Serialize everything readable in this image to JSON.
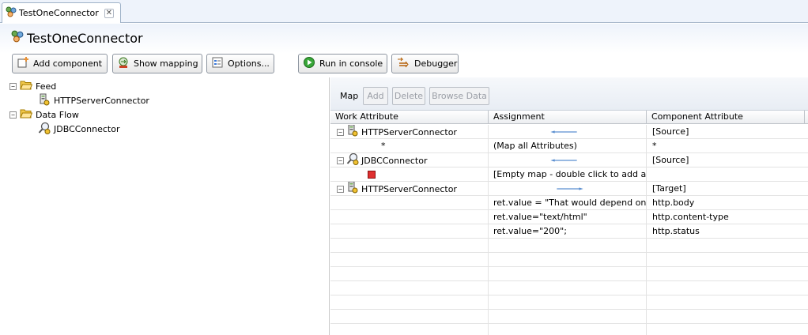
{
  "tab": {
    "label": "TestOneConnector",
    "close_glyph": "✕"
  },
  "header": {
    "title": "TestOneConnector"
  },
  "toolbar": {
    "add_component": "Add component",
    "show_mapping": "Show mapping",
    "options": "Options...",
    "run_in_console": "Run in console",
    "debugger": "Debugger"
  },
  "tree": {
    "feed": {
      "label": "Feed",
      "expanded": true
    },
    "feed_child": {
      "label": "HTTPServerConnector"
    },
    "dataflow": {
      "label": "Data Flow",
      "expanded": true
    },
    "dataflow_child": {
      "label": "JDBCConnector"
    }
  },
  "mapping": {
    "label": "Map",
    "buttons": {
      "add": "Add",
      "delete": "Delete",
      "browse": "Browse Data"
    },
    "columns": [
      "Work Attribute",
      "Assignment",
      "Component Attribute"
    ],
    "rows": [
      {
        "work": "HTTPServerConnector",
        "assignment": "",
        "component": "[Source]",
        "kind": "header",
        "arrow": "left"
      },
      {
        "work": "*",
        "assignment": "(Map all Attributes)",
        "component": "*",
        "kind": "detail"
      },
      {
        "work": "JDBCConnector",
        "assignment": "",
        "component": "[Source]",
        "kind": "header",
        "arrow": "left"
      },
      {
        "work": "",
        "assignment": "[Empty map - double click to add att",
        "component": "",
        "kind": "empty"
      },
      {
        "work": "HTTPServerConnector",
        "assignment": "",
        "component": "[Target]",
        "kind": "header",
        "arrow": "right"
      },
      {
        "work": "",
        "assignment": "ret.value = \"That would depend on y",
        "component": "http.body",
        "kind": "detail"
      },
      {
        "work": "",
        "assignment": "ret.value=\"text/html\"",
        "component": "http.content-type",
        "kind": "detail"
      },
      {
        "work": "",
        "assignment": "ret.value=\"200\";",
        "component": "http.status",
        "kind": "detail"
      }
    ]
  },
  "colors": {
    "accent": "#5b8fd0",
    "error_marker": "#e03030",
    "folder": "#f2c94c"
  },
  "icons": {
    "tab": "assembly-line-icon",
    "title": "assembly-line-icon",
    "add_component": "add-component-icon",
    "show_mapping": "mapping-icon",
    "options": "options-icon",
    "run": "run-icon",
    "debugger": "debug-icon",
    "folder": "folder-open-icon",
    "server": "server-connector-icon",
    "jdbc": "jdbc-connector-icon"
  }
}
